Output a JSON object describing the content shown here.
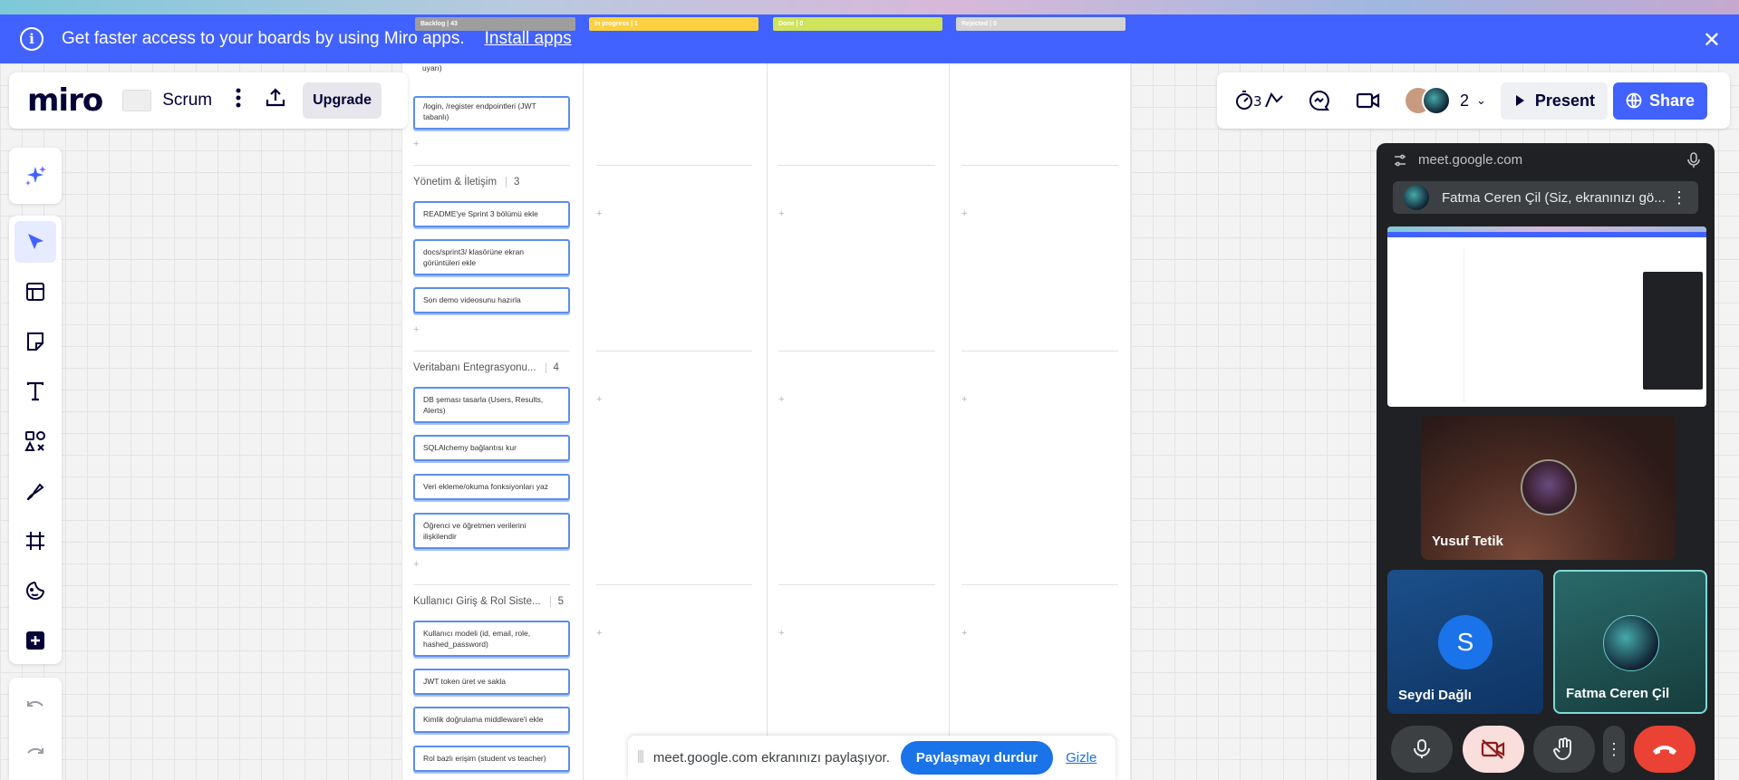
{
  "banner": {
    "message": "Get faster access to your boards by using Miro apps.",
    "link": "Install apps"
  },
  "topbar": {
    "logo": "miro",
    "board_name": "Scrum",
    "upgrade": "Upgrade",
    "collaborator_count": "2",
    "present": "Present",
    "share": "Share",
    "timer_label": "03"
  },
  "board": {
    "columns": [
      {
        "label": "Backlog | 43",
        "color": "#9e9e9e"
      },
      {
        "label": "In progress | 1",
        "color": "#fbd140"
      },
      {
        "label": "Done | 0",
        "color": "#cfe35c"
      },
      {
        "label": "Rejected | 0",
        "color": "#d4d4d4"
      }
    ],
    "top_card_fragment": "uyarı)",
    "top_card": "/login, /register endpointleri (JWT tabanlı)",
    "groups": [
      {
        "title": "Yönetim & İletişim",
        "count": "3",
        "cards": [
          "README'ye Sprint 3 bölümü ekle",
          "docs/sprint3/ klasörüne ekran görüntüleri ekle",
          "Son demo videosunu hazırla"
        ]
      },
      {
        "title": "Veritabanı Entegrasyonu...",
        "count": "4",
        "cards": [
          "DB şeması tasarla (Users, Results, Alerts)",
          "SQLAlchemy bağlantısı kur",
          "Veri ekleme/okuma fonksiyonları yaz",
          "Öğrenci ve öğretmen verilerini ilişkilendir"
        ]
      },
      {
        "title": "Kullanıcı Giriş & Rol Siste...",
        "count": "5",
        "cards": [
          "Kullanıcı modeli (id, email, role, hashed_password)",
          "JWT token üret ve sakla",
          "Kimlik doğrulama middleware'i ekle",
          "Rol bazlı erişim (student vs teacher)"
        ]
      }
    ],
    "plus": "+"
  },
  "meet": {
    "url": "meet.google.com",
    "presenter_text": "Fatma Ceren Çil (Siz, ekranınızı gö...",
    "participants": [
      {
        "name": "Yusuf Tetik"
      },
      {
        "name": "Seydi Dağlı",
        "initial": "S"
      },
      {
        "name": "Fatma Ceren Çil"
      }
    ]
  },
  "sharing": {
    "text": "meet.google.com ekranınızı paylaşıyor.",
    "stop": "Paylaşmayı durdur",
    "hide": "Gizle"
  },
  "colors": {
    "accent": "#4262ff",
    "card_border": "#5b8def",
    "meet_bg": "#202124",
    "end_call": "#ea4335",
    "google_blue": "#1a73e8"
  }
}
